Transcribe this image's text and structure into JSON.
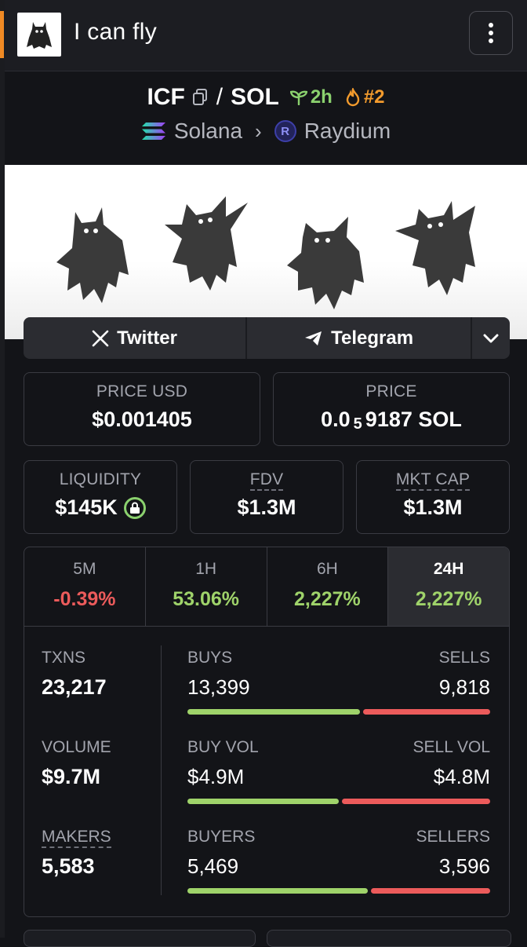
{
  "header": {
    "title": "I can fly",
    "menu_icon": "kebab-vertical-icon"
  },
  "pair": {
    "base": "ICF",
    "separator": "/",
    "quote": "SOL",
    "age": "2h",
    "rank": "#2",
    "age_color": "#8bd16e",
    "rank_color": "#f39b2d"
  },
  "chain": {
    "name": "Solana",
    "dex": "Raydium",
    "dex_letter": "R"
  },
  "socials": {
    "twitter": "Twitter",
    "telegram": "Telegram"
  },
  "prices": {
    "usd_label": "PRICE USD",
    "usd_value": "$0.001405",
    "native_label": "PRICE",
    "native_prefix": "0.0",
    "native_zeros": "5",
    "native_rest": "9187 SOL"
  },
  "metrics": {
    "liquidity_label": "LIQUIDITY",
    "liquidity_value": "$145K",
    "fdv_label": "FDV",
    "fdv_value": "$1.3M",
    "mcap_label": "MKT CAP",
    "mcap_value": "$1.3M"
  },
  "changes": [
    {
      "label": "5M",
      "value": "-0.39%"
    },
    {
      "label": "1H",
      "value": "53.06%"
    },
    {
      "label": "6H",
      "value": "2,227%"
    },
    {
      "label": "24H",
      "value": "2,227%"
    }
  ],
  "stats": {
    "txns_label": "TXNS",
    "txns": "23,217",
    "volume_label": "VOLUME",
    "volume": "$9.7M",
    "makers_label": "MAKERS",
    "makers": "5,583",
    "buys_label": "BUYS",
    "buys": "13,399",
    "sells_label": "SELLS",
    "sells": "9,818",
    "buy_vol_label": "BUY VOL",
    "buy_vol": "$4.9M",
    "sell_vol_label": "SELL VOL",
    "sell_vol": "$4.8M",
    "buyers_label": "BUYERS",
    "buyers": "5,469",
    "sellers_label": "SELLERS",
    "sellers": "3,596",
    "buy_share_txns": 0.577,
    "buy_share_vol": 0.505,
    "buy_share_makers": 0.603
  },
  "colors": {
    "positive": "#9fd36a",
    "negative": "#ec5b5b",
    "accent": "#f08a24"
  }
}
